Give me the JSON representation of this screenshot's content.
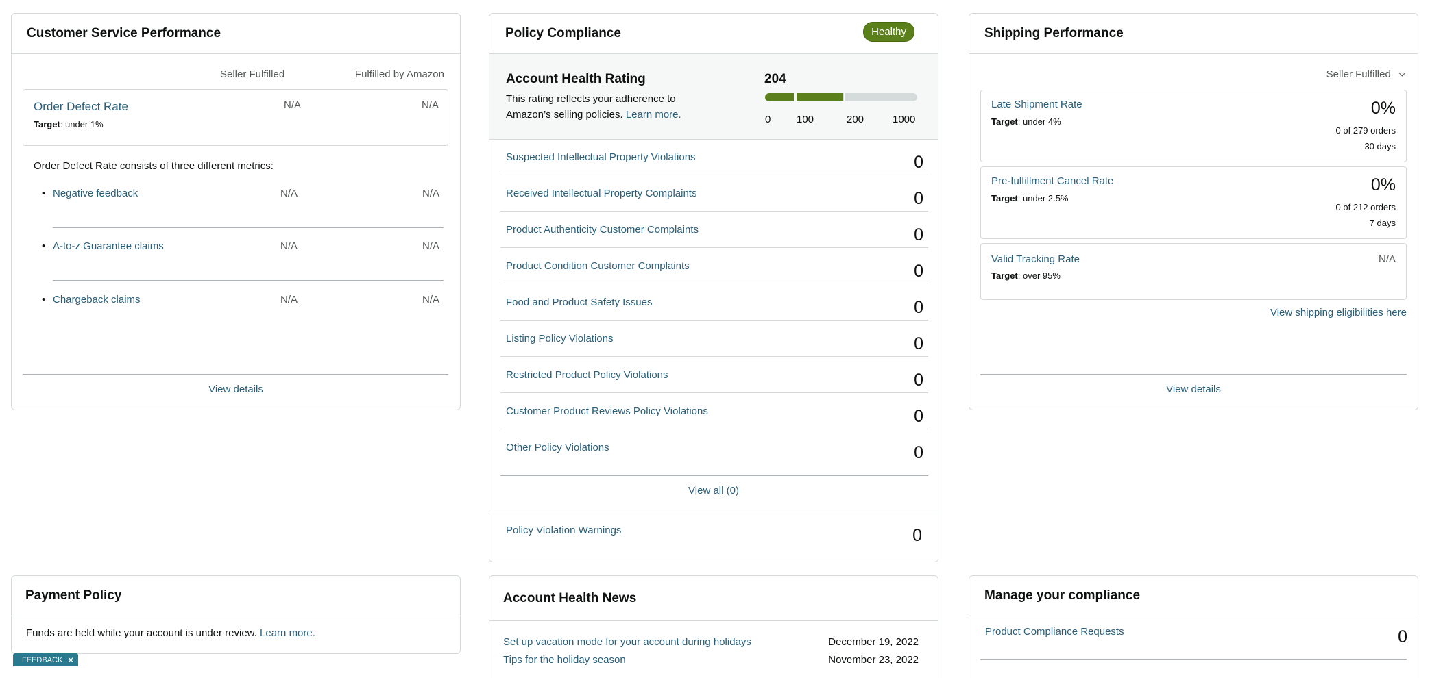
{
  "csp": {
    "title": "Customer Service Performance",
    "col_seller": "Seller Fulfilled",
    "col_fba": "Fulfilled by Amazon",
    "odr": {
      "label": "Order Defect Rate",
      "target_label": "Target",
      "target_value": ": under 1%",
      "seller": "N/A",
      "fba": "N/A"
    },
    "consists_text": "Order Defect Rate consists of three different metrics:",
    "metrics": [
      {
        "label": "Negative feedback",
        "seller": "N/A",
        "fba": "N/A"
      },
      {
        "label": "A-to-z Guarantee claims",
        "seller": "N/A",
        "fba": "N/A"
      },
      {
        "label": "Chargeback claims",
        "seller": "N/A",
        "fba": "N/A"
      }
    ],
    "view_details": "View details"
  },
  "policy": {
    "title": "Policy Compliance",
    "badge": "Healthy",
    "ahr_title": "Account Health Rating",
    "ahr_desc_1": "This rating reflects your adherence to",
    "ahr_desc_2": "Amazon’s selling policies.",
    "learn_more": "Learn more.",
    "score": "204",
    "score_value": 204,
    "scale": [
      "0",
      "100",
      "200",
      "1000"
    ],
    "colors": {
      "good": "#5b7f1a",
      "track": "#d5dbdb"
    },
    "items": [
      {
        "label": "Suspected Intellectual Property Violations",
        "count": "0"
      },
      {
        "label": "Received Intellectual Property Complaints",
        "count": "0"
      },
      {
        "label": "Product Authenticity Customer Complaints",
        "count": "0"
      },
      {
        "label": "Product Condition Customer Complaints",
        "count": "0"
      },
      {
        "label": "Food and Product Safety Issues",
        "count": "0"
      },
      {
        "label": "Listing Policy Violations",
        "count": "0"
      },
      {
        "label": "Restricted Product Policy Violations",
        "count": "0"
      },
      {
        "label": "Customer Product Reviews Policy Violations",
        "count": "0"
      },
      {
        "label": "Other Policy Violations",
        "count": "0"
      }
    ],
    "view_all": "View all (0)",
    "warnings": {
      "label": "Policy Violation Warnings",
      "count": "0"
    }
  },
  "shipping": {
    "title": "Shipping Performance",
    "dropdown": "Seller Fulfilled",
    "metrics": [
      {
        "label": "Late Shipment Rate",
        "target_label": "Target",
        "target_value": ": under 4%",
        "value": "0%",
        "orders": "0 of 279 orders",
        "period": "30 days"
      },
      {
        "label": "Pre-fulfillment Cancel Rate",
        "target_label": "Target",
        "target_value": ": under 2.5%",
        "value": "0%",
        "orders": "0 of 212 orders",
        "period": "7 days"
      },
      {
        "label": "Valid Tracking Rate",
        "target_label": "Target",
        "target_value": ": over 95%",
        "value": "N/A"
      }
    ],
    "eligibilities_link": "View shipping eligibilities here",
    "view_details": "View details"
  },
  "payment": {
    "title": "Payment Policy",
    "text": "Funds are held while your account is under review.",
    "learn_more": "Learn more."
  },
  "news": {
    "title": "Account Health News",
    "items": [
      {
        "label": "Set up vacation mode for your account during holidays",
        "date": "December 19, 2022"
      },
      {
        "label": "Tips for the holiday season",
        "date": "November 23, 2022"
      }
    ]
  },
  "compliance": {
    "title": "Manage your compliance",
    "item": {
      "label": "Product Compliance Requests",
      "count": "0"
    }
  },
  "feedback": {
    "label": "FEEDBACK",
    "close": "✕"
  }
}
